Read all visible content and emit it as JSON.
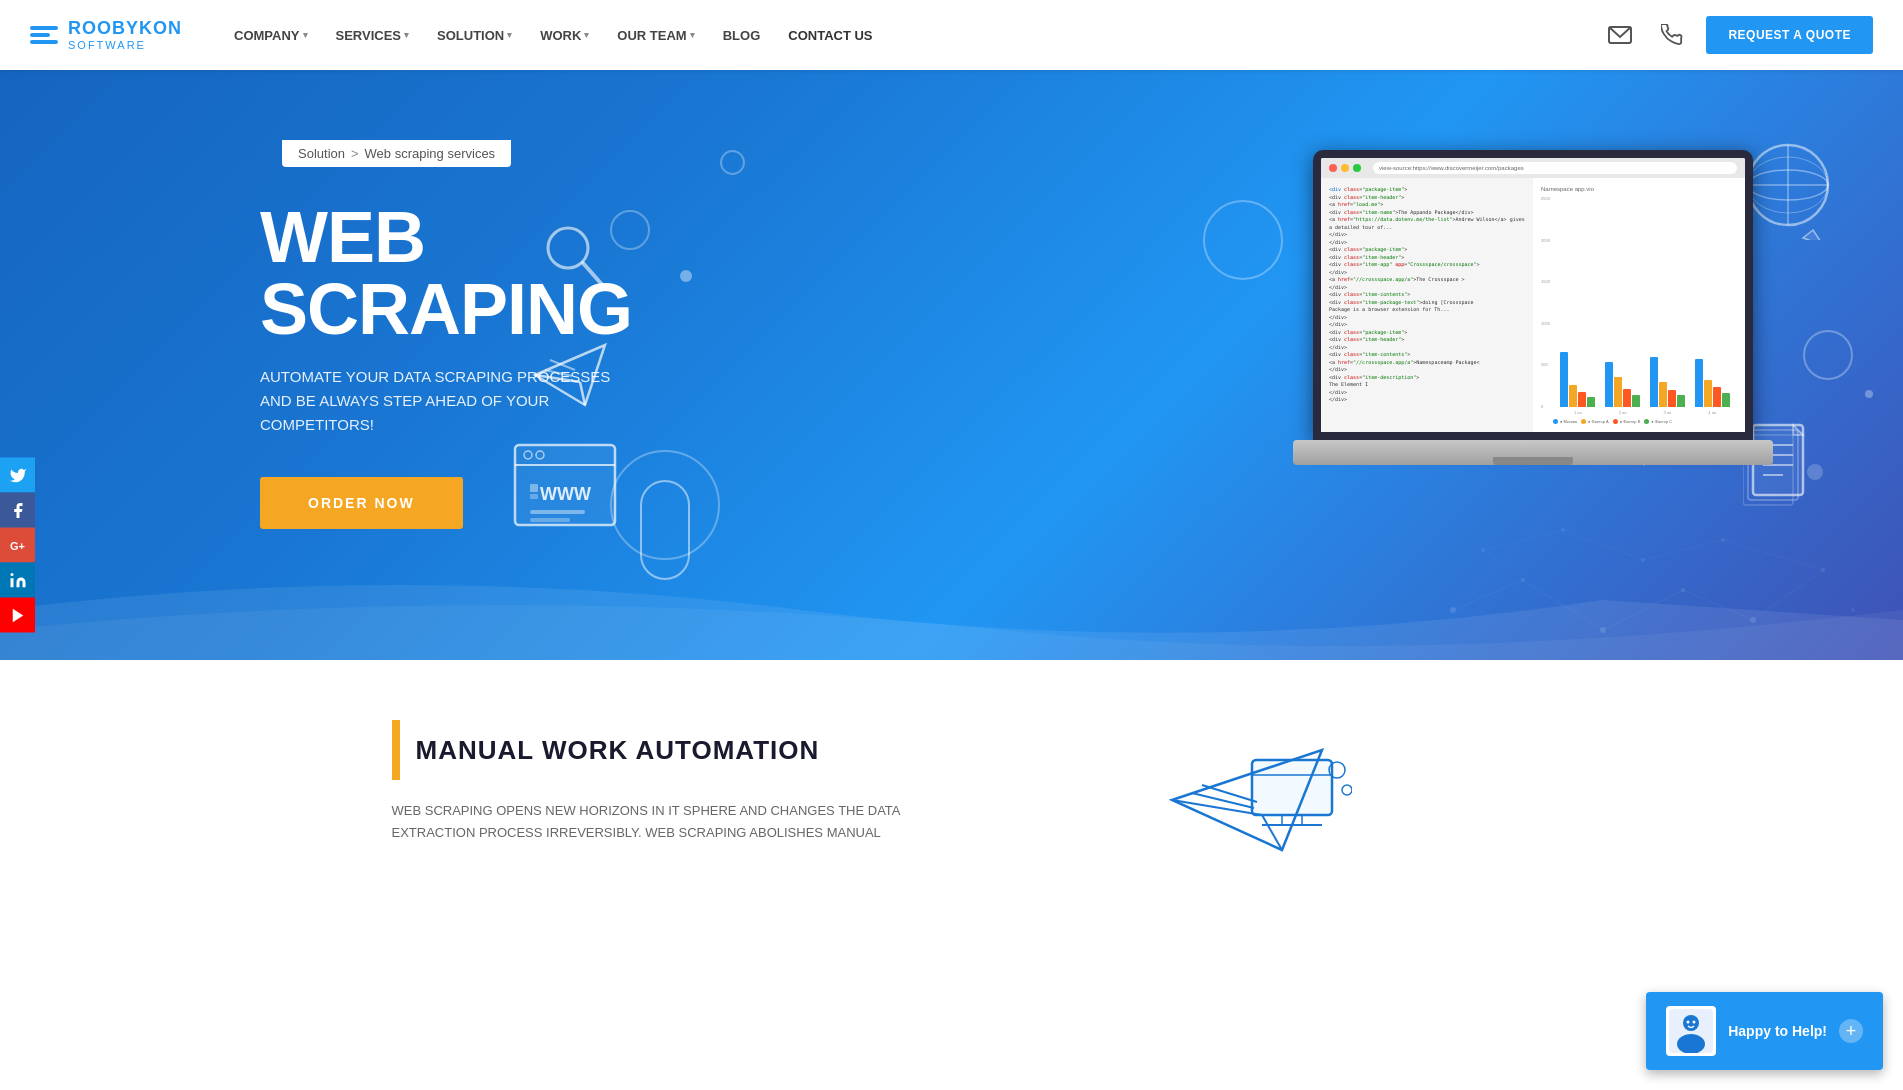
{
  "header": {
    "logo": {
      "brand": "ROOBYKON",
      "sub": "SOFTWARE"
    },
    "nav": [
      {
        "label": "COMPANY",
        "has_dropdown": true
      },
      {
        "label": "SERVICES",
        "has_dropdown": true
      },
      {
        "label": "SOLUTION",
        "has_dropdown": true
      },
      {
        "label": "WORK",
        "has_dropdown": true
      },
      {
        "label": "OUR TEAM",
        "has_dropdown": true
      },
      {
        "label": "BLOG",
        "has_dropdown": false
      },
      {
        "label": "CONTACT US",
        "has_dropdown": false
      }
    ],
    "cta_button": "REQUEST A QUOTE"
  },
  "breadcrumb": {
    "parent": "Solution",
    "separator": ">",
    "current": "Web scraping services"
  },
  "hero": {
    "title_line1": "WEB",
    "title_line2": "SCRAPING",
    "subtitle": "AUTOMATE YOUR DATA SCRAPING PROCESSES AND BE ALWAYS STEP AHEAD OF YOUR COMPETITORS!",
    "cta_button": "ORDER NOW"
  },
  "social": {
    "items": [
      {
        "name": "twitter",
        "icon": "𝕏"
      },
      {
        "name": "facebook",
        "icon": "f"
      },
      {
        "name": "googleplus",
        "icon": "G+"
      },
      {
        "name": "linkedin",
        "icon": "in"
      },
      {
        "name": "youtube",
        "icon": "▶"
      }
    ]
  },
  "section": {
    "title": "MANUAL WORK AUTOMATION",
    "accent_color": "#F5A623",
    "text": "WEB SCRAPING OPENS NEW HORIZONS IN IT SPHERE AND CHANGES THE DATA EXTRACTION PROCESS IRREVERSIBLY. WEB SCRAPING ABOLISHES MANUAL"
  },
  "chat_widget": {
    "label": "Happy to Help!"
  },
  "laptop": {
    "url": "view-source:https://www.discovermeijer.com/packages",
    "chart": {
      "groups": [
        {
          "label": "1 яя",
          "bars": [
            60,
            25,
            15,
            10
          ]
        },
        {
          "label": "2 яя",
          "bars": [
            45,
            35,
            20,
            15
          ]
        },
        {
          "label": "3 яя",
          "bars": [
            55,
            30,
            20,
            12
          ]
        },
        {
          "label": "4 яя",
          "bars": [
            50,
            28,
            22,
            18
          ]
        }
      ],
      "legend": [
        "Москва",
        "Фактор A",
        "Фактор B",
        "Фактор C"
      ]
    }
  }
}
